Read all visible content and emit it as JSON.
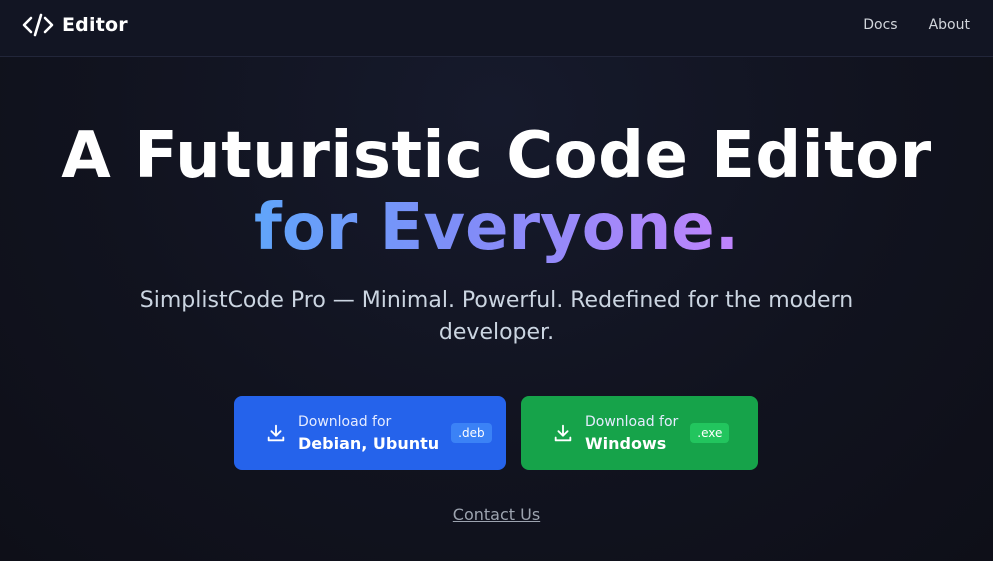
{
  "nav": {
    "brand": "Editor",
    "brand_icon": "code-brackets-icon",
    "links": [
      "Docs",
      "About"
    ]
  },
  "hero": {
    "title_line1": "A Futuristic Code Editor",
    "title_line2": "for Everyone.",
    "subtitle": "SimplistCode Pro — Minimal. Powerful. Redefined for the modern developer."
  },
  "downloads": [
    {
      "line1": "Download for",
      "line2": "Debian, Ubuntu",
      "badge": ".deb",
      "icon": "download-icon",
      "color": "#2563eb"
    },
    {
      "line1": "Download for",
      "line2": "Windows",
      "badge": ".exe",
      "icon": "download-icon",
      "color": "#16a34a"
    }
  ],
  "contact_link": "Contact Us"
}
